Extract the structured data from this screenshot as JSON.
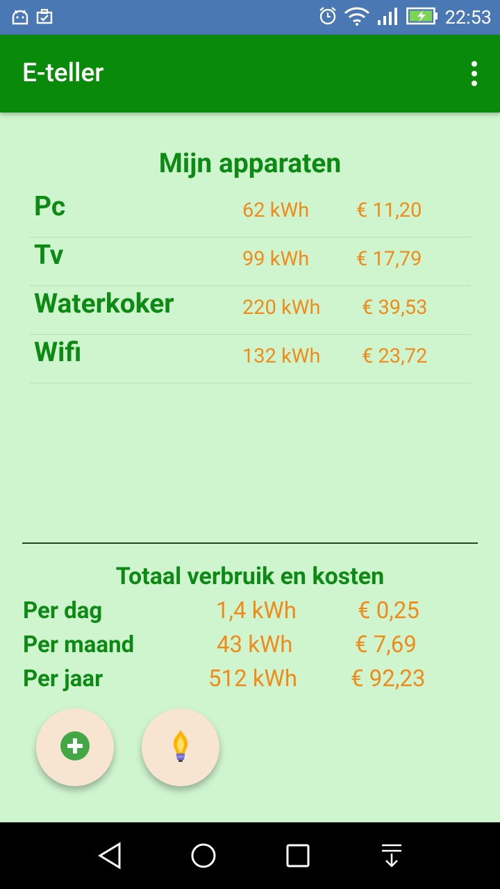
{
  "status_bar": {
    "time": "22:53",
    "icons": [
      "android-icon",
      "briefcase-icon",
      "alarm-icon",
      "wifi-icon",
      "signal-icon",
      "battery-charging-icon"
    ]
  },
  "app_bar": {
    "title": "E-teller",
    "menu_icon": "overflow-menu-icon"
  },
  "devices": {
    "title": "Mijn apparaten",
    "items": [
      {
        "name": "Pc",
        "kwh": "62 kWh",
        "cost": "€ 11,20"
      },
      {
        "name": "Tv",
        "kwh": "99 kWh",
        "cost": "€ 17,79"
      },
      {
        "name": "Waterkoker",
        "kwh": "220 kWh",
        "cost": "€ 39,53"
      },
      {
        "name": "Wifi",
        "kwh": "132 kWh",
        "cost": "€ 23,72"
      }
    ]
  },
  "totals": {
    "title": "Totaal verbruik en kosten",
    "rows": [
      {
        "label": "Per dag",
        "kwh": "1,4 kWh",
        "cost": "€ 0,25"
      },
      {
        "label": "Per maand",
        "kwh": "43 kWh",
        "cost": "€ 7,69"
      },
      {
        "label": "Per jaar",
        "kwh": "512 kWh",
        "cost": "€ 92,23"
      }
    ]
  },
  "fabs": [
    {
      "icon": "add-icon"
    },
    {
      "icon": "lightbulb-icon"
    }
  ],
  "nav_bar": {
    "icons": [
      "back-icon",
      "home-icon",
      "recents-icon",
      "notifications-pull-icon"
    ]
  },
  "colors": {
    "status_bar": "#4a78b5",
    "app_bar": "#0a8a0a",
    "background": "#cff5cf",
    "green_text": "#0d8a14",
    "orange_text": "#f08a18",
    "fab": "#f7e4d1"
  }
}
